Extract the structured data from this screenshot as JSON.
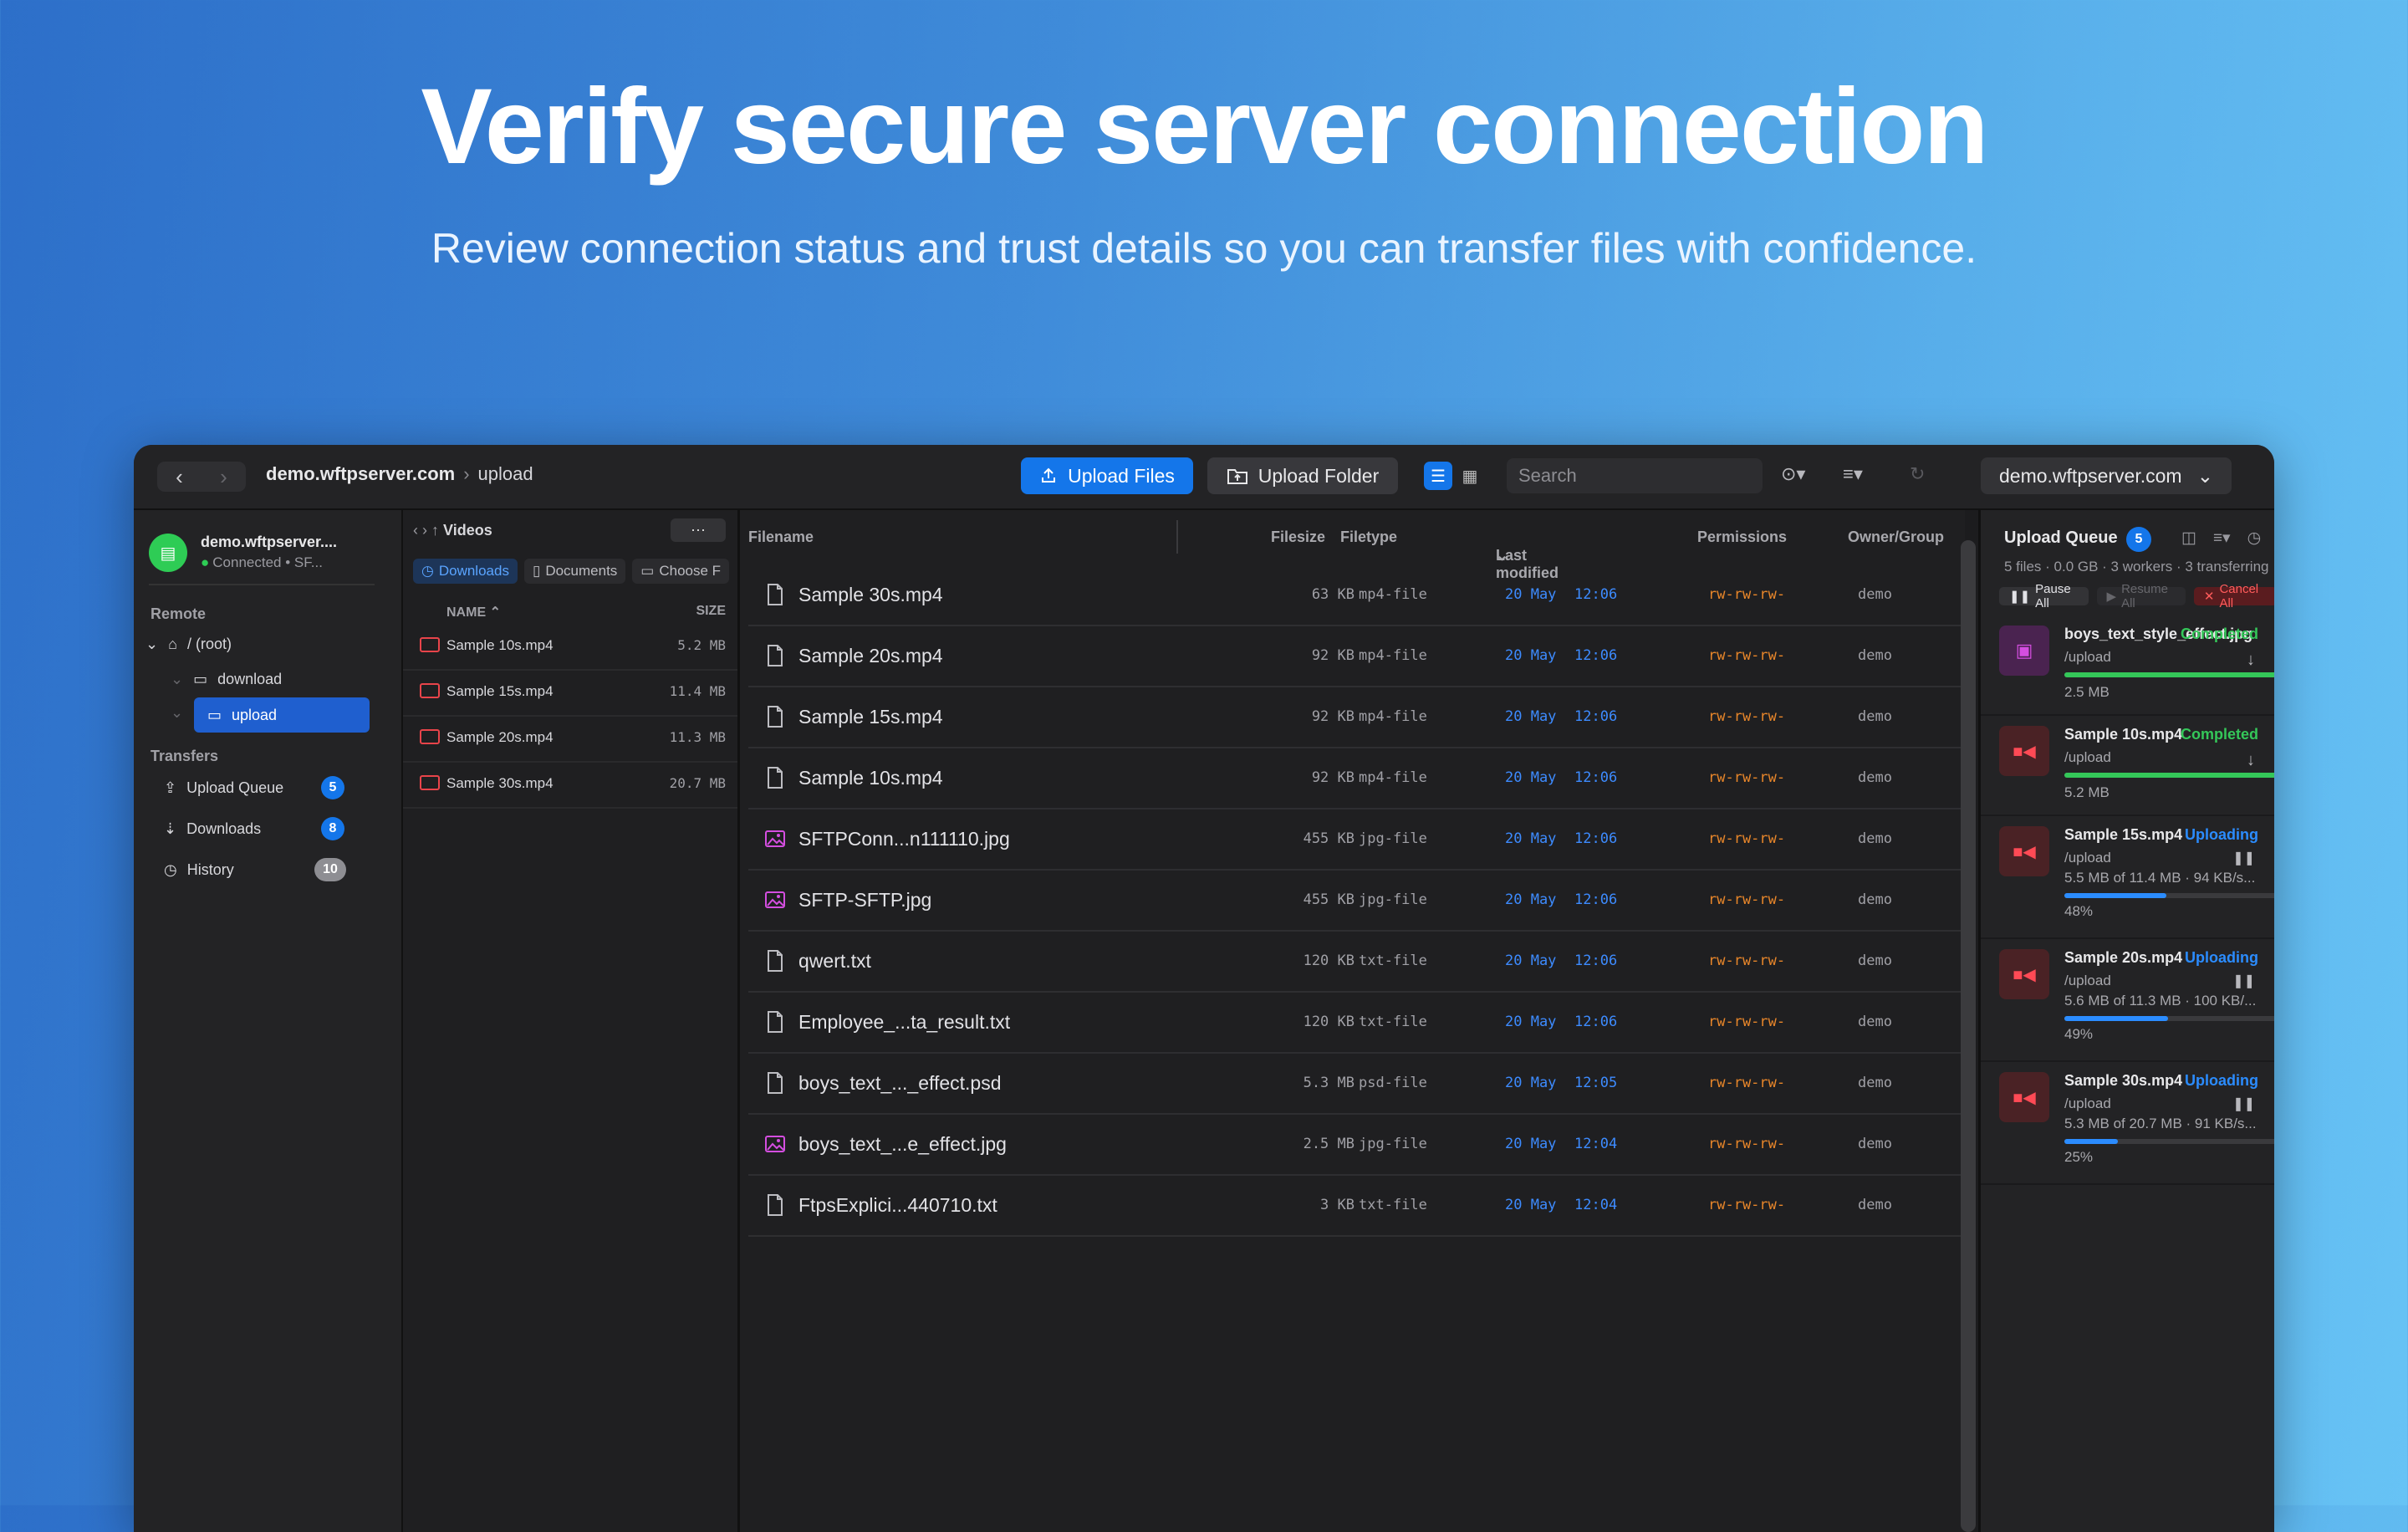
{
  "hero": {
    "title": "Verify secure server connection",
    "subtitle": "Review connection status and trust details so you can transfer files with confidence."
  },
  "toolbar": {
    "host": "demo.wftpserver.com",
    "path": "upload",
    "upload_files": "Upload Files",
    "upload_folder": "Upload Folder",
    "search_placeholder": "Search",
    "server": "demo.wftpserver.com"
  },
  "sidebar": {
    "server_name": "demo.wftpserver....",
    "server_status": "Connected • SF...",
    "remote_heading": "Remote",
    "tree": [
      {
        "label": "/ (root)"
      },
      {
        "label": "download"
      },
      {
        "label": "upload"
      }
    ],
    "transfers_heading": "Transfers",
    "transfers": [
      {
        "label": "Upload Queue",
        "count": "5"
      },
      {
        "label": "Downloads",
        "count": "8"
      },
      {
        "label": "History",
        "count": "10"
      }
    ]
  },
  "local": {
    "path": "Videos",
    "chips": [
      "Downloads",
      "Documents",
      "Choose F"
    ],
    "col_name": "NAME",
    "col_size": "SIZE",
    "files": [
      {
        "name": "Sample 10s.mp4",
        "size": "5.2 MB"
      },
      {
        "name": "Sample 15s.mp4",
        "size": "11.4 MB"
      },
      {
        "name": "Sample 20s.mp4",
        "size": "11.3 MB"
      },
      {
        "name": "Sample 30s.mp4",
        "size": "20.7 MB"
      }
    ]
  },
  "remote": {
    "columns": {
      "filename": "Filename",
      "filesize": "Filesize",
      "filetype": "Filetype",
      "modified": "Last modified",
      "permissions": "Permissions",
      "owner": "Owner/Group"
    },
    "files": [
      {
        "name": "Sample 30s.mp4",
        "size": "63 KB",
        "type": "mp4-file",
        "date": "20 May",
        "time": "12:06",
        "perm": "rw-rw-rw-",
        "owner": "demo",
        "icon": "doc"
      },
      {
        "name": "Sample 20s.mp4",
        "size": "92 KB",
        "type": "mp4-file",
        "date": "20 May",
        "time": "12:06",
        "perm": "rw-rw-rw-",
        "owner": "demo",
        "icon": "doc"
      },
      {
        "name": "Sample 15s.mp4",
        "size": "92 KB",
        "type": "mp4-file",
        "date": "20 May",
        "time": "12:06",
        "perm": "rw-rw-rw-",
        "owner": "demo",
        "icon": "doc"
      },
      {
        "name": "Sample 10s.mp4",
        "size": "92 KB",
        "type": "mp4-file",
        "date": "20 May",
        "time": "12:06",
        "perm": "rw-rw-rw-",
        "owner": "demo",
        "icon": "doc"
      },
      {
        "name": "SFTPConn...n111110.jpg",
        "size": "455 KB",
        "type": "jpg-file",
        "date": "20 May",
        "time": "12:06",
        "perm": "rw-rw-rw-",
        "owner": "demo",
        "icon": "image"
      },
      {
        "name": "SFTP-SFTP.jpg",
        "size": "455 KB",
        "type": "jpg-file",
        "date": "20 May",
        "time": "12:06",
        "perm": "rw-rw-rw-",
        "owner": "demo",
        "icon": "image"
      },
      {
        "name": "qwert.txt",
        "size": "120 KB",
        "type": "txt-file",
        "date": "20 May",
        "time": "12:06",
        "perm": "rw-rw-rw-",
        "owner": "demo",
        "icon": "doc"
      },
      {
        "name": "Employee_...ta_result.txt",
        "size": "120 KB",
        "type": "txt-file",
        "date": "20 May",
        "time": "12:06",
        "perm": "rw-rw-rw-",
        "owner": "demo",
        "icon": "doc"
      },
      {
        "name": "boys_text_..._effect.psd",
        "size": "5.3 MB",
        "type": "psd-file",
        "date": "20 May",
        "time": "12:05",
        "perm": "rw-rw-rw-",
        "owner": "demo",
        "icon": "doc"
      },
      {
        "name": "boys_text_...e_effect.jpg",
        "size": "2.5 MB",
        "type": "jpg-file",
        "date": "20 May",
        "time": "12:04",
        "perm": "rw-rw-rw-",
        "owner": "demo",
        "icon": "image"
      },
      {
        "name": "FtpsExplici...440710.txt",
        "size": "3 KB",
        "type": "txt-file",
        "date": "20 May",
        "time": "12:04",
        "perm": "rw-rw-rw-",
        "owner": "demo",
        "icon": "doc"
      }
    ]
  },
  "queue": {
    "title": "Upload Queue",
    "count": "5",
    "summary": "5 files · 0.0 GB · 3 workers · 3 transferring",
    "pause_all": "Pause All",
    "resume_all": "Resume All",
    "cancel_all": "Cancel All",
    "items": [
      {
        "name": "boys_text_style_effect.jpg",
        "path": "/upload",
        "status": "Completed",
        "detail": "2.5 MB",
        "percent_label": "",
        "progress": 1.0,
        "kind": "image"
      },
      {
        "name": "Sample 10s.mp4",
        "path": "/upload",
        "status": "Completed",
        "detail": "5.2 MB",
        "percent_label": "",
        "progress": 1.0,
        "kind": "video"
      },
      {
        "name": "Sample 15s.mp4",
        "path": "/upload",
        "status": "Uploading",
        "detail": "5.5 MB of 11.4 MB · 94 KB/s...",
        "percent_label": "48%",
        "progress": 0.48,
        "kind": "video"
      },
      {
        "name": "Sample 20s.mp4",
        "path": "/upload",
        "status": "Uploading",
        "detail": "5.6 MB of 11.3 MB · 100 KB/...",
        "percent_label": "49%",
        "progress": 0.49,
        "kind": "video"
      },
      {
        "name": "Sample 30s.mp4",
        "path": "/upload",
        "status": "Uploading",
        "detail": "5.3 MB of 20.7 MB · 91 KB/s...",
        "percent_label": "25%",
        "progress": 0.25,
        "kind": "video"
      }
    ]
  },
  "colors": {
    "accent": "#1476ea",
    "completed": "#34c759",
    "uploading": "#2b8cff",
    "permissions": "#e8862a",
    "date": "#3d8bff"
  }
}
